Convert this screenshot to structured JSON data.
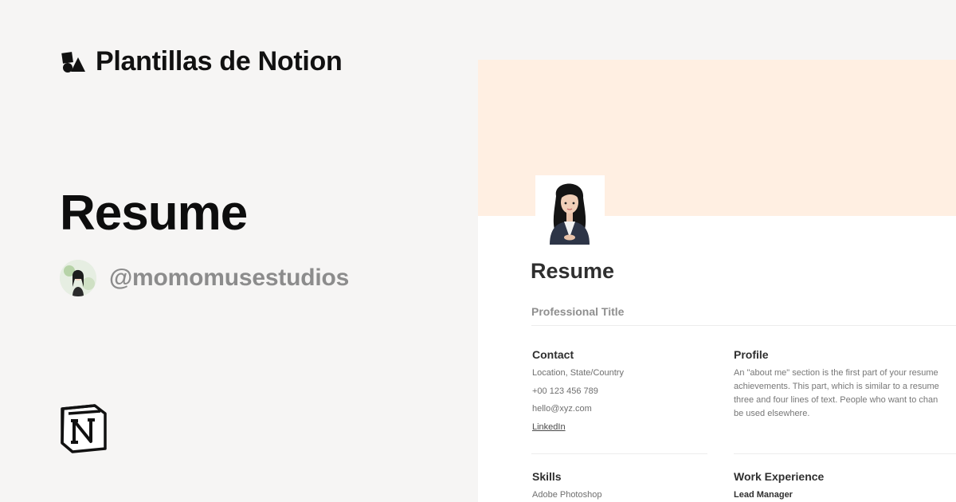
{
  "brand": {
    "name": "Plantillas de Notion",
    "icon": "shapes-icon"
  },
  "template": {
    "title": "Resume"
  },
  "author": {
    "handle": "@momomusestudios",
    "icon": "avatar"
  },
  "notion_logo": {
    "icon": "notion-logo-icon"
  },
  "preview": {
    "page_title": "Resume",
    "professional_title": "Professional Title",
    "contact": {
      "heading": "Contact",
      "location": "Location, State/Country",
      "phone": "+00 123 456 789",
      "email": "hello@xyz.com",
      "linkedin": "LinkedIn"
    },
    "profile": {
      "heading": "Profile",
      "lines": [
        "An \"about me\" section is the first part of your resume",
        "achievements. This part, which is similar to a resume",
        "three and four lines of text. People who want to chan",
        "be used elsewhere."
      ]
    },
    "skills": {
      "heading": "Skills",
      "items": [
        "Adobe Photoshop"
      ]
    },
    "work_experience": {
      "heading": "Work Experience",
      "role": "Lead Manager"
    }
  },
  "colors": {
    "background": "#f6f5f4",
    "cover": "#ffefe2",
    "handle": "#8c8c8c"
  }
}
